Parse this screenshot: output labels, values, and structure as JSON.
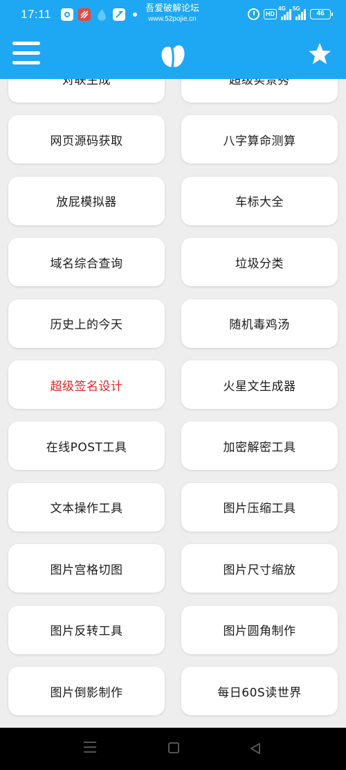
{
  "status_bar": {
    "time": "17:11",
    "watermark_title": "吾爱破解论坛",
    "watermark_url": "www.52pojie.cn",
    "hd_label": "HD",
    "net1": "4G",
    "net2": "5G",
    "battery": "46"
  },
  "header": {
    "menu_icon": "hamburger-menu-icon",
    "logo_icon": "app-logo-icon",
    "favorite_icon": "star-icon",
    "background": "#1ea7f2"
  },
  "tiles": [
    {
      "label": "对联生成",
      "highlight": false
    },
    {
      "label": "超级实景秀",
      "highlight": false
    },
    {
      "label": "网页源码获取",
      "highlight": false
    },
    {
      "label": "八字算命测算",
      "highlight": false
    },
    {
      "label": "放屁模拟器",
      "highlight": false
    },
    {
      "label": "车标大全",
      "highlight": false
    },
    {
      "label": "域名综合查询",
      "highlight": false
    },
    {
      "label": "垃圾分类",
      "highlight": false
    },
    {
      "label": "历史上的今天",
      "highlight": false
    },
    {
      "label": "随机毒鸡汤",
      "highlight": false
    },
    {
      "label": "超级签名设计",
      "highlight": true
    },
    {
      "label": "火星文生成器",
      "highlight": false
    },
    {
      "label": "在线POST工具",
      "highlight": false
    },
    {
      "label": "加密解密工具",
      "highlight": false
    },
    {
      "label": "文本操作工具",
      "highlight": false
    },
    {
      "label": "图片压缩工具",
      "highlight": false
    },
    {
      "label": "图片宫格切图",
      "highlight": false
    },
    {
      "label": "图片尺寸缩放",
      "highlight": false
    },
    {
      "label": "图片反转工具",
      "highlight": false
    },
    {
      "label": "图片圆角制作",
      "highlight": false
    },
    {
      "label": "图片倒影制作",
      "highlight": false
    },
    {
      "label": "每日60S读世界",
      "highlight": false
    }
  ],
  "colors": {
    "accent": "#1ea7f2",
    "highlight_text": "#e02424",
    "page_bg": "#eeeeee"
  }
}
